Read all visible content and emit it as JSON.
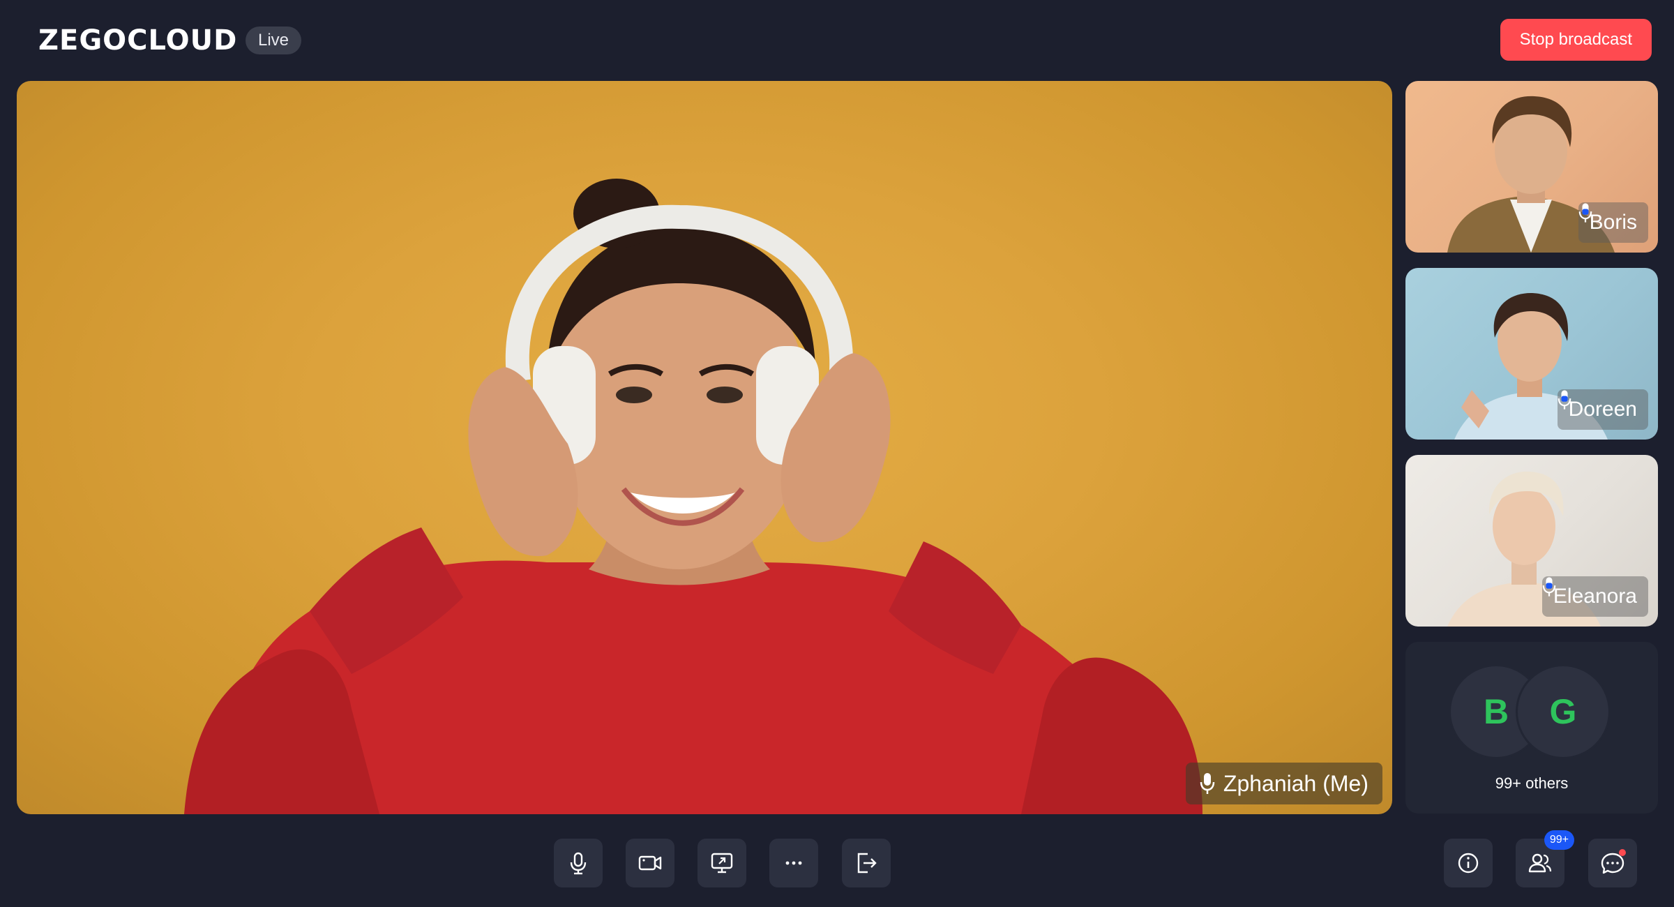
{
  "header": {
    "logo": "ZEGOCLOUD",
    "live_badge": "Live",
    "stop_button": "Stop broadcast"
  },
  "main_video": {
    "participant_name": "Zphaniah (Me)"
  },
  "side_tiles": [
    {
      "name": "Boris"
    },
    {
      "name": "Doreen"
    },
    {
      "name": "Eleanora"
    }
  ],
  "others": {
    "avatars": [
      "B",
      "G"
    ],
    "label": "99+ others"
  },
  "toolbar": {
    "participants_badge": "99+"
  },
  "colors": {
    "background": "#1c1f2e",
    "stop_button": "#ff4a50",
    "avatar_letter": "#2ec45c",
    "badge": "#1b57f7"
  }
}
